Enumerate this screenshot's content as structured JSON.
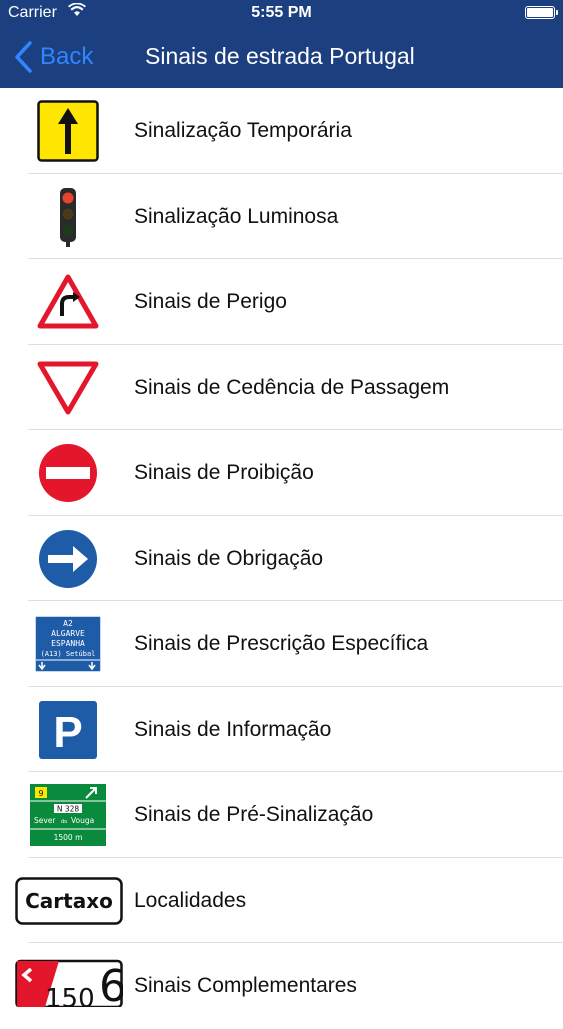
{
  "status_bar": {
    "carrier": "Carrier",
    "time": "5:55 PM"
  },
  "nav": {
    "back_label": "Back",
    "title": "Sinais de estrada Portugal"
  },
  "categories": [
    {
      "label": "Sinalização Temporária",
      "icon": "temporary-sign-arrow-icon"
    },
    {
      "label": "Sinalização Luminosa",
      "icon": "traffic-light-icon"
    },
    {
      "label": "Sinais de Perigo",
      "icon": "danger-triangle-icon"
    },
    {
      "label": "Sinais de Cedência de Passagem",
      "icon": "yield-triangle-icon"
    },
    {
      "label": "Sinais de Proibição",
      "icon": "no-entry-icon"
    },
    {
      "label": "Sinais de Obrigação",
      "icon": "mandatory-arrow-icon"
    },
    {
      "label": "Sinais de Prescrição Específica",
      "icon": "direction-sign-icon"
    },
    {
      "label": "Sinais de Informação",
      "icon": "parking-sign-icon"
    },
    {
      "label": "Sinais de Pré-Sinalização",
      "icon": "pre-signal-sign-icon"
    },
    {
      "label": "Localidades",
      "icon": "locality-sign-icon"
    },
    {
      "label": "Sinais Complementares",
      "icon": "complementary-sign-icon"
    }
  ],
  "sign_texts": {
    "direction": {
      "road": "A2",
      "line1": "ALGARVE",
      "line2": "ESPANHA",
      "line3": "(A13) Setúbal"
    },
    "pre_signal": {
      "exit": "9",
      "route": "N 328",
      "place": "Sever",
      "place_sub": "do",
      "place2": "Vouga",
      "distance": "1500 m"
    },
    "locality": "Cartaxo",
    "complementary": "150",
    "complementary_big": "6",
    "parking": "P"
  },
  "colors": {
    "nav_bg": "#1c3f80",
    "back_blue": "#2f86ff",
    "sign_red": "#e3162b",
    "sign_blue": "#1f5ca8",
    "sign_green": "#0a8a3c",
    "temp_yellow": "#ffe600"
  }
}
